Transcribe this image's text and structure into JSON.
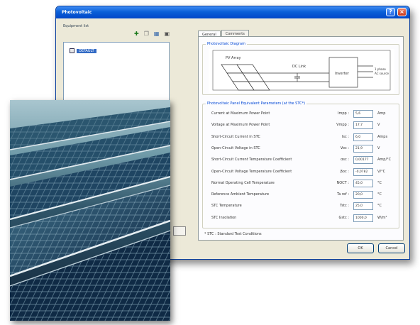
{
  "window": {
    "title": "Photovoltaic",
    "help_icon": "?",
    "close_icon": "×"
  },
  "left_panel": {
    "label": "Equipment list",
    "toolbar_icons": [
      "add-icon",
      "copy-icon",
      "database-icon",
      "save-icon"
    ],
    "tree_items": [
      {
        "label": "DEFAULT"
      }
    ]
  },
  "tabs": [
    {
      "label": "General",
      "active": true
    },
    {
      "label": "Comments",
      "active": false
    }
  ],
  "diagram_group": {
    "title": "Photovoltaic Diagram",
    "pv_array": "PV Array",
    "dc_link": "DC Link",
    "inverter": "Inverter",
    "output_lines": [
      "1 phase",
      "AC source"
    ]
  },
  "params_group": {
    "title": "Photovoltaic Panel Equivalent Parameters (at the STC*)",
    "rows": [
      {
        "label": "Current at Maximum Power Point",
        "sym": "Impp :",
        "value": "5,6",
        "unit": "Amp"
      },
      {
        "label": "Voltage at Maximum Power Point",
        "sym": "Vmpp :",
        "value": "17,7",
        "unit": "V"
      },
      {
        "label": "Short-Circuit Current in STC",
        "sym": "Isc :",
        "value": "6,0",
        "unit": "Amps"
      },
      {
        "label": "Open-Circuit Voltage in STC",
        "sym": "Voc :",
        "value": "21,9",
        "unit": "V"
      },
      {
        "label": "Short-Circuit Current Temperature Coefficient",
        "sym": "αsc :",
        "value": "0,00177",
        "unit": "Amp/°C"
      },
      {
        "label": "Open-Circuit Voltage Temperature Coefficient",
        "sym": "βoc :",
        "value": "-0,0782",
        "unit": "V/°C"
      },
      {
        "label": "Normal Operating Cell Temperature",
        "sym": "NOCT :",
        "value": "45,0",
        "unit": "°C"
      },
      {
        "label": "Reference Ambient Temperature",
        "sym": "Ta ref :",
        "value": "20,0",
        "unit": "°C"
      },
      {
        "label": "STC Temperature",
        "sym": "Tstc :",
        "value": "25,0",
        "unit": "°C"
      },
      {
        "label": "STC Insolation",
        "sym": "Gstc :",
        "value": "1000,0",
        "unit": "W/m²"
      }
    ]
  },
  "footnote": "* STC : Standard Test Conditions",
  "buttons": {
    "ok": "OK",
    "cancel": "Cancel"
  }
}
